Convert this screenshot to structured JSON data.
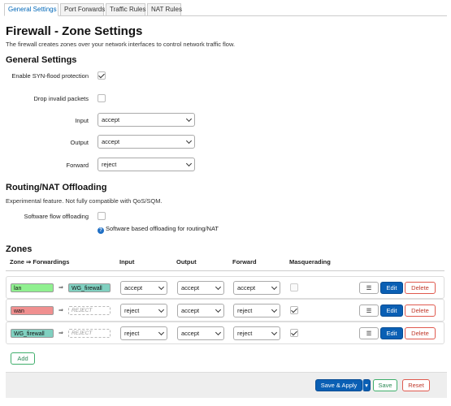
{
  "tabs": [
    "General Settings",
    "Port Forwards",
    "Traffic Rules",
    "NAT Rules"
  ],
  "page_title": "Firewall - Zone Settings",
  "page_description": "The firewall creates zones over your network interfaces to control network traffic flow.",
  "general": {
    "heading": "General Settings",
    "syn_flood_label": "Enable SYN-flood protection",
    "syn_flood_checked": true,
    "drop_invalid_label": "Drop invalid packets",
    "drop_invalid_checked": false,
    "input_label": "Input",
    "input_value": "accept",
    "output_label": "Output",
    "output_value": "accept",
    "forward_label": "Forward",
    "forward_value": "reject"
  },
  "offloading": {
    "heading": "Routing/NAT Offloading",
    "description": "Experimental feature. Not fully compatible with QoS/SQM.",
    "sw_label": "Software flow offloading",
    "sw_checked": false,
    "help": "Software based offloading for routing/NAT"
  },
  "zones": {
    "heading": "Zones",
    "columns": {
      "zone": "Zone ⇒ Forwardings",
      "input": "Input",
      "output": "Output",
      "forward": "Forward",
      "masq": "Masquerading"
    },
    "rows": [
      {
        "name": "lan",
        "name_color": "#90f090",
        "target": "WG_firewall",
        "target_color": "#80d0c0",
        "target_is_reject": false,
        "input": "accept",
        "output": "accept",
        "forward": "accept",
        "masq": false,
        "masq_disabled": true
      },
      {
        "name": "wan",
        "name_color": "#f09090",
        "target": "REJECT",
        "target_color": "",
        "target_is_reject": true,
        "input": "reject",
        "output": "accept",
        "forward": "reject",
        "masq": true,
        "masq_disabled": false
      },
      {
        "name": "WG_firewall",
        "name_color": "#80d0c0",
        "target": "REJECT",
        "target_color": "",
        "target_is_reject": true,
        "input": "reject",
        "output": "accept",
        "forward": "reject",
        "masq": true,
        "masq_disabled": false
      }
    ],
    "arrow": "⇒",
    "menu_button": "☰",
    "edit_button": "Edit",
    "delete_button": "Delete",
    "add_button": "Add"
  },
  "footer": {
    "save_apply": "Save & Apply",
    "dropdown_arrow": "▾",
    "save": "Save",
    "reset": "Reset"
  }
}
